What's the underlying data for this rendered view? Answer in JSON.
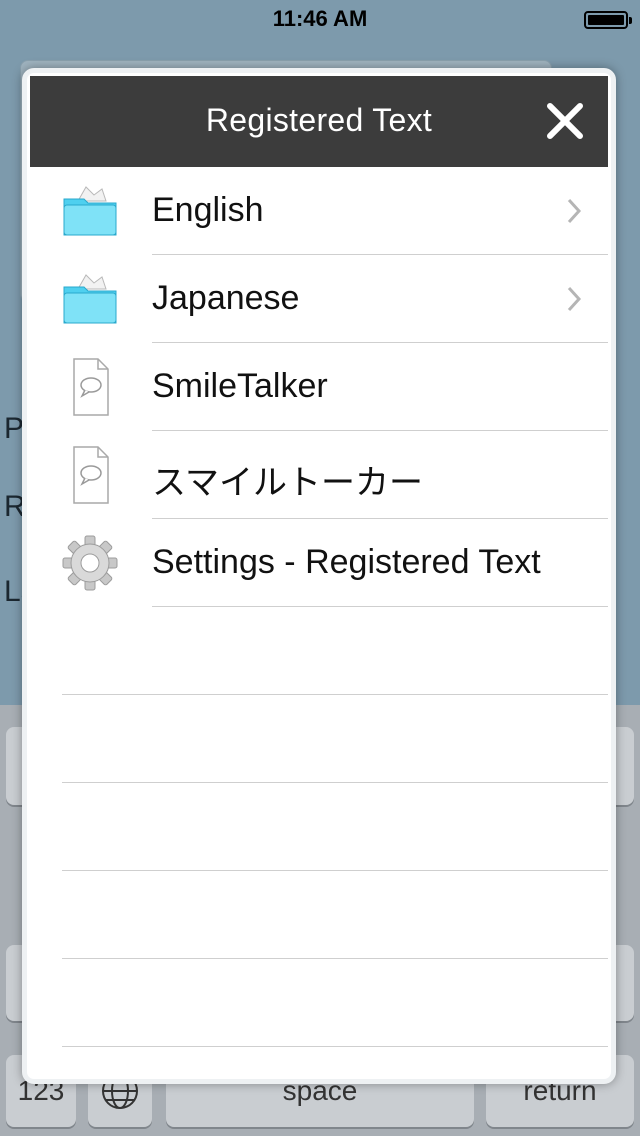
{
  "status_bar": {
    "time": "11:46 AM"
  },
  "background": {
    "labels": [
      "Pi",
      "R",
      "La"
    ],
    "keyboard": {
      "num_key": "123",
      "space_key": "space",
      "return_key": "return"
    }
  },
  "modal": {
    "title": "Registered Text",
    "items": [
      {
        "label": "English",
        "icon": "folder-icon",
        "has_chevron": true
      },
      {
        "label": "Japanese",
        "icon": "folder-icon",
        "has_chevron": true
      },
      {
        "label": "SmileTalker",
        "icon": "document-speech-icon",
        "has_chevron": false
      },
      {
        "label": "スマイルトーカー",
        "icon": "document-speech-icon",
        "has_chevron": false
      },
      {
        "label": "Settings - Registered Text",
        "icon": "gear-icon",
        "has_chevron": false
      }
    ]
  },
  "colors": {
    "header_bg": "#3c3c3c",
    "folder": "#4fd0ef",
    "separator": "#cfcfcf"
  }
}
